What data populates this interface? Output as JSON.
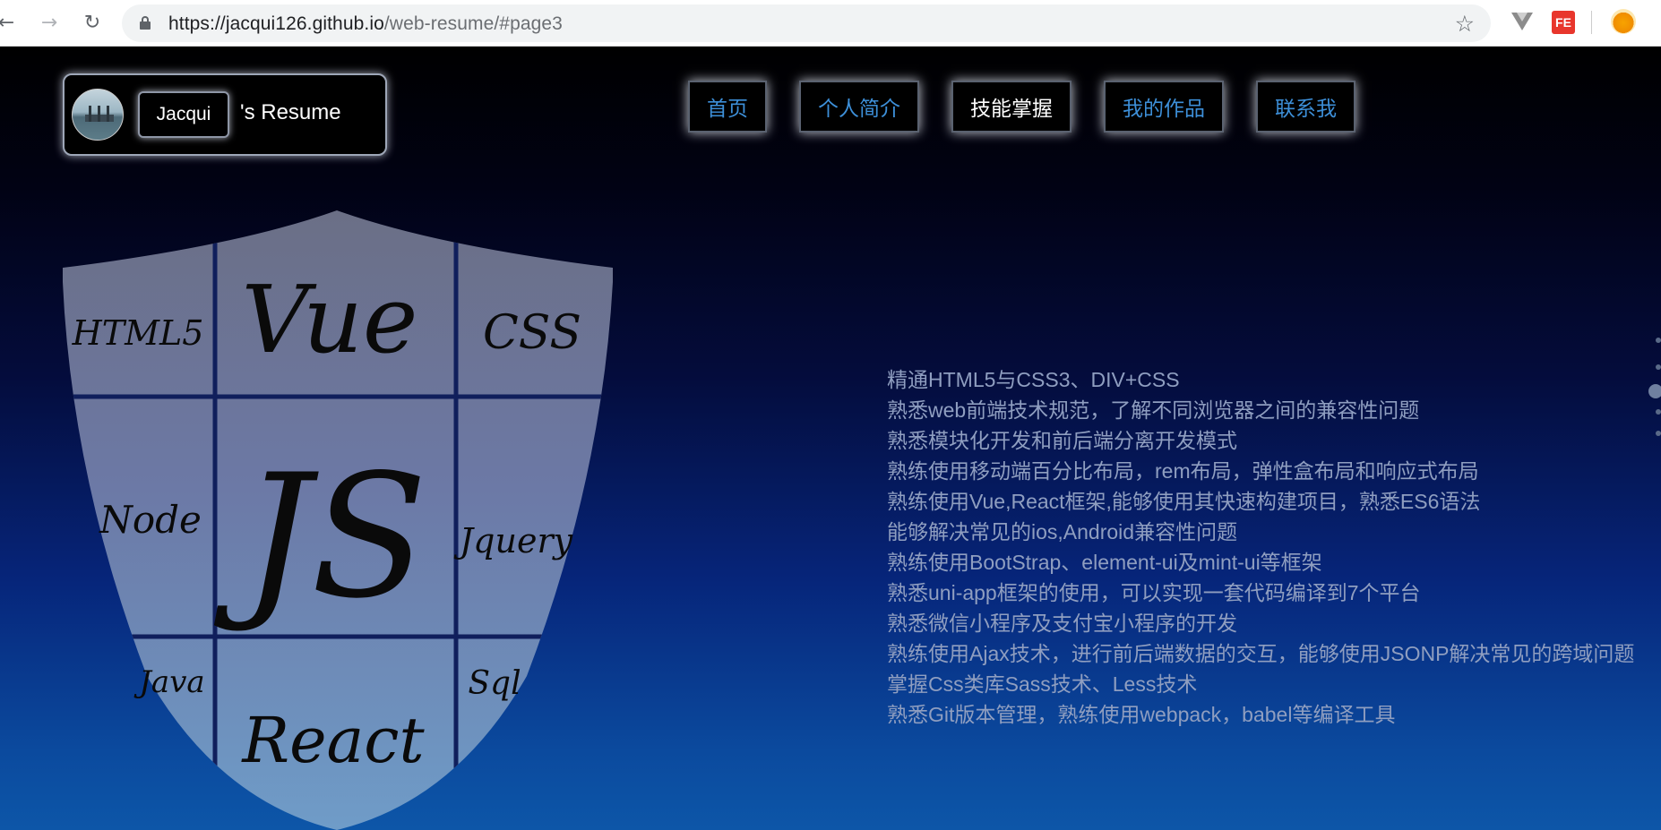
{
  "browser": {
    "url_host": "https://jacqui126.github.io",
    "url_path": "/web-resume/#page3",
    "back_icon": "arrow-left-icon",
    "forward_icon": "arrow-right-icon",
    "reload_icon": "reload-icon",
    "bookmark_icon": "star-icon",
    "extensions": [
      "vue-devtools-icon",
      "fe-helper-icon",
      "fox-extension-icon"
    ],
    "fe_label": "FE"
  },
  "brand": {
    "name": "Jacqui",
    "suffix": "'s Resume"
  },
  "nav": {
    "items": [
      {
        "label": "首页",
        "active": false
      },
      {
        "label": "个人简介",
        "active": false
      },
      {
        "label": "技能掌握",
        "active": true
      },
      {
        "label": "我的作品",
        "active": false
      },
      {
        "label": "联系我",
        "active": false
      }
    ]
  },
  "shield": {
    "labels": {
      "html5": "HTML5",
      "vue": "Vue",
      "css": "CSS",
      "node": "Node",
      "js": "JS",
      "jquery": "Jquery",
      "java": "Java",
      "react": "React",
      "sql": "Sql"
    }
  },
  "skills": [
    "精通HTML5与CSS3、DIV+CSS",
    "熟悉web前端技术规范，了解不同浏览器之间的兼容性问题",
    "熟悉模块化开发和前后端分离开发模式",
    "熟练使用移动端百分比布局，rem布局，弹性盒布局和响应式布局",
    "熟练使用Vue,React框架,能够使用其快速构建项目，熟悉ES6语法",
    "能够解决常见的ios,Android兼容性问题",
    "熟练使用BootStrap、element-ui及mint-ui等框架",
    "熟悉uni-app框架的使用，可以实现一套代码编译到7个平台",
    "熟悉微信小程序及支付宝小程序的开发",
    "熟练使用Ajax技术，进行前后端数据的交互，能够使用JSONP解决常见的跨域问题",
    "掌握Css类库Sass技术、Less技术",
    "熟悉Git版本管理，熟练使用webpack，babel等编译工具"
  ],
  "page_dots": {
    "count": 5,
    "active_index": 2
  },
  "colors": {
    "nav_link": "#3d8fd8",
    "nav_active": "#ffffff",
    "skill_text": "#8f9ec0"
  }
}
